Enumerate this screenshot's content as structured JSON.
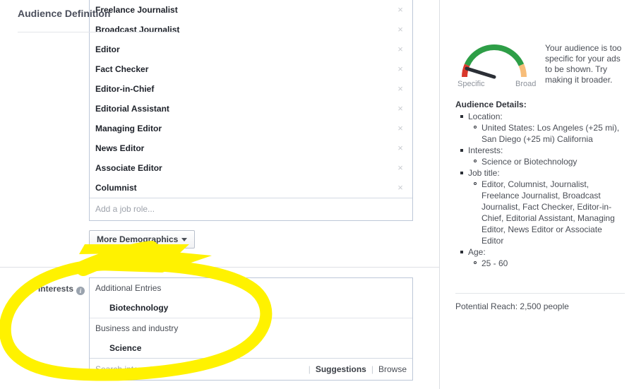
{
  "job_roles": {
    "items": [
      {
        "label": "Freelance Journalist",
        "remove_icon": "close-icon"
      },
      {
        "label": "Broadcast Journalist",
        "remove_icon": "close-icon"
      },
      {
        "label": "Editor",
        "remove_icon": "close-icon"
      },
      {
        "label": "Fact Checker",
        "remove_icon": "close-icon"
      },
      {
        "label": "Editor-in-Chief",
        "remove_icon": "close-icon"
      },
      {
        "label": "Editorial Assistant",
        "remove_icon": "close-icon"
      },
      {
        "label": "Managing Editor",
        "remove_icon": "close-icon"
      },
      {
        "label": "News Editor",
        "remove_icon": "close-icon"
      },
      {
        "label": "Associate Editor",
        "remove_icon": "close-icon"
      },
      {
        "label": "Columnist",
        "remove_icon": "close-icon"
      }
    ],
    "input_placeholder": "Add a job role...",
    "remove_glyph": "×"
  },
  "more_demographics": {
    "label": "More Demographics",
    "caret_icon": "chevron-down-icon"
  },
  "interests": {
    "label": "Interests",
    "info_icon": "info-icon",
    "info_glyph": "i",
    "groups": [
      {
        "header": "Additional Entries",
        "items": [
          "Biotechnology"
        ]
      },
      {
        "header": "Business and industry",
        "items": [
          "Science"
        ]
      }
    ],
    "search_placeholder": "Search interests",
    "suggestions_label": "Suggestions",
    "browse_label": "Browse"
  },
  "annotation": {
    "type": "hand-drawn-ellipse-highlight",
    "color": "#FFF200"
  },
  "audience": {
    "title": "Audience Definition",
    "gauge": {
      "specific_label": "Specific",
      "broad_label": "Broad",
      "red_color": "#d9382c",
      "green_color": "#2e9e47",
      "orange_color": "#f7bd7a",
      "needle_color": "#2b2f36"
    },
    "message": "Your audience is too specific for your ads to be shown. Try making it broader.",
    "details_title": "Audience Details:",
    "details": [
      {
        "label": "Location:",
        "values": [
          "United States: Los Angeles (+25 mi), San Diego (+25 mi) California"
        ]
      },
      {
        "label": "Interests:",
        "values": [
          "Science or Biotechnology"
        ]
      },
      {
        "label": "Job title:",
        "values": [
          "Editor, Columnist, Journalist, Freelance Journalist, Broadcast Journalist, Fact Checker, Editor-in-Chief, Editorial Assistant, Managing Editor, News Editor or Associate Editor"
        ]
      },
      {
        "label": "Age:",
        "values": [
          "25 - 60"
        ]
      }
    ],
    "potential_reach": "Potential Reach: 2,500 people"
  }
}
